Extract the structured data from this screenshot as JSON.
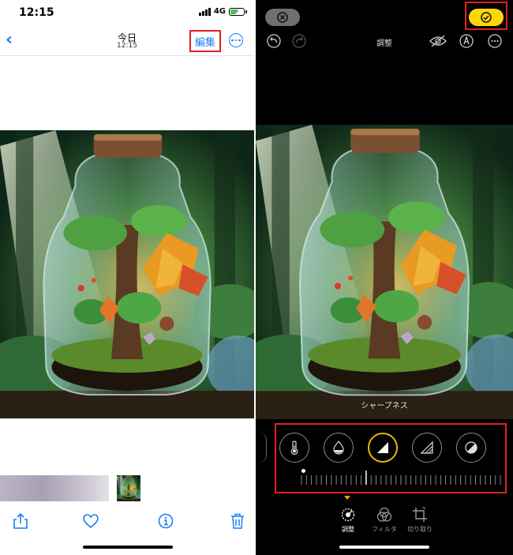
{
  "left": {
    "status": {
      "time": "12:15",
      "network": "4G"
    },
    "nav": {
      "title": "今日",
      "subtitle": "12:15",
      "edit_label": "編集"
    },
    "toolbar": [
      "share-icon",
      "heart-icon",
      "info-icon",
      "trash-icon"
    ]
  },
  "right": {
    "title": "調整",
    "photo_label": "シャープネス",
    "adjustments": [
      "thermometer-icon",
      "droplet-icon",
      "sharpness-icon",
      "definition-icon",
      "noise-reduction-icon"
    ],
    "active_adjustment": "sharpness-icon",
    "tabs": [
      {
        "label": "調整",
        "icon": "adjust-dial-icon",
        "active": true
      },
      {
        "label": "フィルタ",
        "icon": "filters-icon",
        "active": false
      },
      {
        "label": "切り取り",
        "icon": "crop-icon",
        "active": false
      }
    ]
  },
  "colors": {
    "accent_blue": "#1a7ef6",
    "highlight_red": "#e02020",
    "done_yellow": "#ffd60a",
    "active_ring": "#e8b800"
  }
}
